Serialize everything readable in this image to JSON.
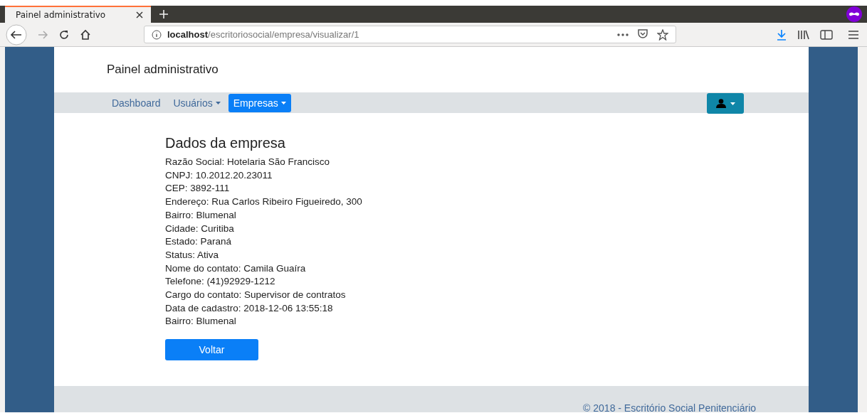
{
  "browser": {
    "tab_title": "Painel administrativo",
    "url_host": "localhost",
    "url_path": "/escritoriosocial/empresa/visualizar/1"
  },
  "header": {
    "title": "Painel administrativo"
  },
  "nav": [
    {
      "label": "Dashboard",
      "selected": false,
      "dropdown": false
    },
    {
      "label": "Usuários",
      "selected": false,
      "dropdown": true
    },
    {
      "label": "Empresas",
      "selected": true,
      "dropdown": true
    }
  ],
  "main": {
    "heading": "Dados da empresa",
    "fields": [
      "Razão Social: Hotelaria São Francisco",
      "CNPJ: 10.2012.20.23011",
      "CEP: 3892-111",
      "Endereço: Rua Carlos Ribeiro Figueiredo, 300",
      "Bairro: Blumenal",
      "Cidade: Curitiba",
      "Estado: Paraná",
      "Status: Ativa",
      "Nome do contato: Camila Guaíra",
      "Telefone: (41)92929-1212",
      "Cargo do contato: Supervisor de contratos",
      "Data de cadastro: 2018-12-06 13:55:18",
      "Bairro: Blumenal"
    ],
    "button": "Voltar"
  },
  "footer": "© 2018 - Escritório Social Penitenciário"
}
